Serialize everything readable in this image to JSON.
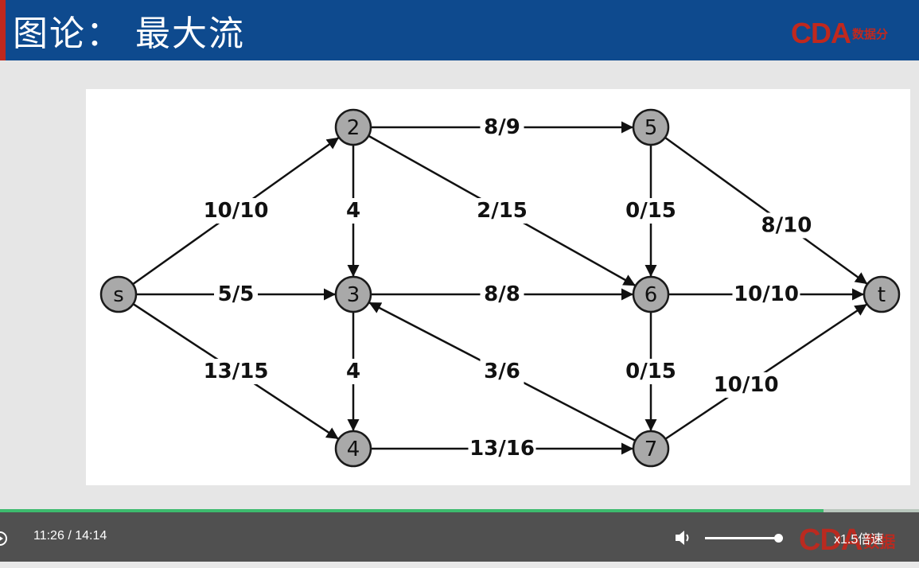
{
  "slide": {
    "title": "图论： 最大流",
    "logo_text": "CDA",
    "logo_cn": "数据分"
  },
  "graph": {
    "nodes": [
      {
        "id": "s",
        "label": "s"
      },
      {
        "id": "2",
        "label": "2"
      },
      {
        "id": "3",
        "label": "3"
      },
      {
        "id": "4",
        "label": "4"
      },
      {
        "id": "5",
        "label": "5"
      },
      {
        "id": "6",
        "label": "6"
      },
      {
        "id": "7",
        "label": "7"
      },
      {
        "id": "t",
        "label": "t"
      }
    ],
    "edges": [
      {
        "from": "s",
        "to": "2",
        "label": "10/10"
      },
      {
        "from": "s",
        "to": "3",
        "label": "5/5"
      },
      {
        "from": "s",
        "to": "4",
        "label": "13/15"
      },
      {
        "from": "2",
        "to": "5",
        "label": "8/9"
      },
      {
        "from": "2",
        "to": "3",
        "label": "4"
      },
      {
        "from": "2",
        "to": "6",
        "label": "2/15"
      },
      {
        "from": "3",
        "to": "6",
        "label": "8/8"
      },
      {
        "from": "3",
        "to": "4",
        "label": "4"
      },
      {
        "from": "7",
        "to": "3",
        "label": "3/6"
      },
      {
        "from": "4",
        "to": "7",
        "label": "13/16"
      },
      {
        "from": "5",
        "to": "6",
        "label": "0/15"
      },
      {
        "from": "5",
        "to": "t",
        "label": "8/10"
      },
      {
        "from": "6",
        "to": "t",
        "label": "10/10"
      },
      {
        "from": "6",
        "to": "7",
        "label": "0/15"
      },
      {
        "from": "7",
        "to": "t",
        "label": "10/10"
      }
    ]
  },
  "player": {
    "current_time": "11:26",
    "separator": "/",
    "total_time": "14:14",
    "progress": 0.896,
    "volume": 1.0,
    "speed_label": "x1.5倍速",
    "logo_text": "CDA",
    "logo_cn": "数据",
    "icons": [
      "play-icon",
      "volume-icon"
    ]
  }
}
